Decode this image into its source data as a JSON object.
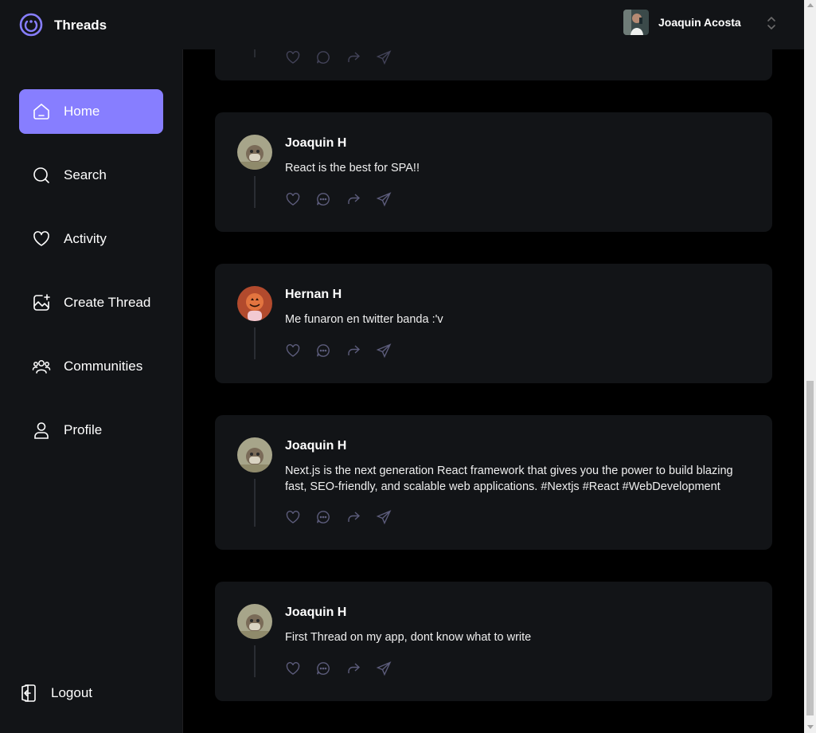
{
  "app": {
    "title": "Threads",
    "accent": "#877eff"
  },
  "user": {
    "name": "Joaquin Acosta"
  },
  "nav": {
    "items": [
      {
        "label": "Home",
        "icon": "home-icon",
        "active": true
      },
      {
        "label": "Search",
        "icon": "search-icon"
      },
      {
        "label": "Activity",
        "icon": "heart-icon"
      },
      {
        "label": "Create Thread",
        "icon": "create-thread-icon"
      },
      {
        "label": "Communities",
        "icon": "communities-icon"
      },
      {
        "label": "Profile",
        "icon": "profile-icon"
      }
    ],
    "logout": "Logout"
  },
  "threads": [
    {
      "author": "Joaquin H",
      "text": "React is the best for SPA!!",
      "avatar": "raccoon"
    },
    {
      "author": "Hernan H",
      "text": "Me funaron en twitter banda :'v",
      "avatar": "pumpkin"
    },
    {
      "author": "Joaquin H",
      "text": "Next.js is the next generation React framework that gives you the power to build blazing fast, SEO-friendly, and scalable web applications. #Nextjs #React #WebDevelopment",
      "avatar": "raccoon"
    },
    {
      "author": "Joaquin H",
      "text": "First Thread on my app, dont know what to write",
      "avatar": "raccoon"
    }
  ]
}
